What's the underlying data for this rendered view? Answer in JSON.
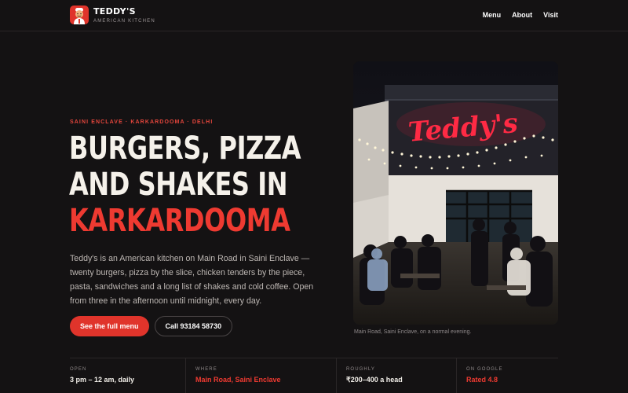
{
  "brand": {
    "name": "TEDDY'S",
    "tagline": "AMERICAN KITCHEN",
    "logo_icon": "chef-mascot-icon"
  },
  "nav": {
    "items": [
      "Menu",
      "About",
      "Visit"
    ]
  },
  "hero": {
    "eyebrow": "SAINI ENCLAVE · KARKARDOOMA · DELHI",
    "headline_line1": "BURGERS, PIZZA",
    "headline_line2": "AND SHAKES IN",
    "headline_accent": "KARKARDOOMA",
    "intro": "Teddy's is an American kitchen on Main Road in Saini Enclave — twenty burgers, pizza by the slice, chicken tenders by the piece, pasta, sandwiches and a long list of shakes and cold coffee. Open from three in the afternoon until midnight, every day.",
    "primary_button": "See the full menu",
    "secondary_button": "Call 93184 58730"
  },
  "photo": {
    "sign_text": "Teddy's",
    "caption": "Main Road, Saini Enclave, on a normal evening."
  },
  "info": [
    {
      "label": "OPEN",
      "value": "3 pm – 12 am, daily"
    },
    {
      "label": "WHERE",
      "value": "Main Road, Saini Enclave"
    },
    {
      "label": "ROUGHLY",
      "value": "₹200–400 a head"
    },
    {
      "label": "ON GOOGLE",
      "value": "Rated 4.8"
    }
  ],
  "colors": {
    "background": "#141213",
    "accent": "#e0342b",
    "text": "#f2efe9",
    "muted": "#bdb7b3"
  }
}
